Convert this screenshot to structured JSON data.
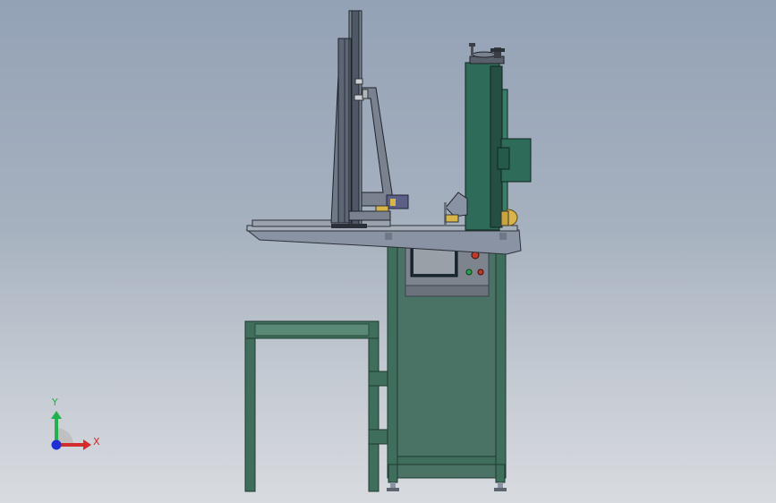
{
  "viewport": {
    "background_top": "#94a2b6",
    "background_bottom": "#d8dbe0"
  },
  "model": {
    "frame_color": "#3f6e5c",
    "frame_dark": "#2d4f42",
    "cabinet_color": "#4a7366",
    "column_color": "#2e6b58",
    "steel_color": "#8a93a3",
    "screen_color": "#9aa0a8"
  },
  "triad": {
    "y_label": "Y",
    "x_label": "X",
    "y_color": "#22b14c",
    "x_color": "#d22c2c",
    "z_color": "#1e2fd6"
  }
}
